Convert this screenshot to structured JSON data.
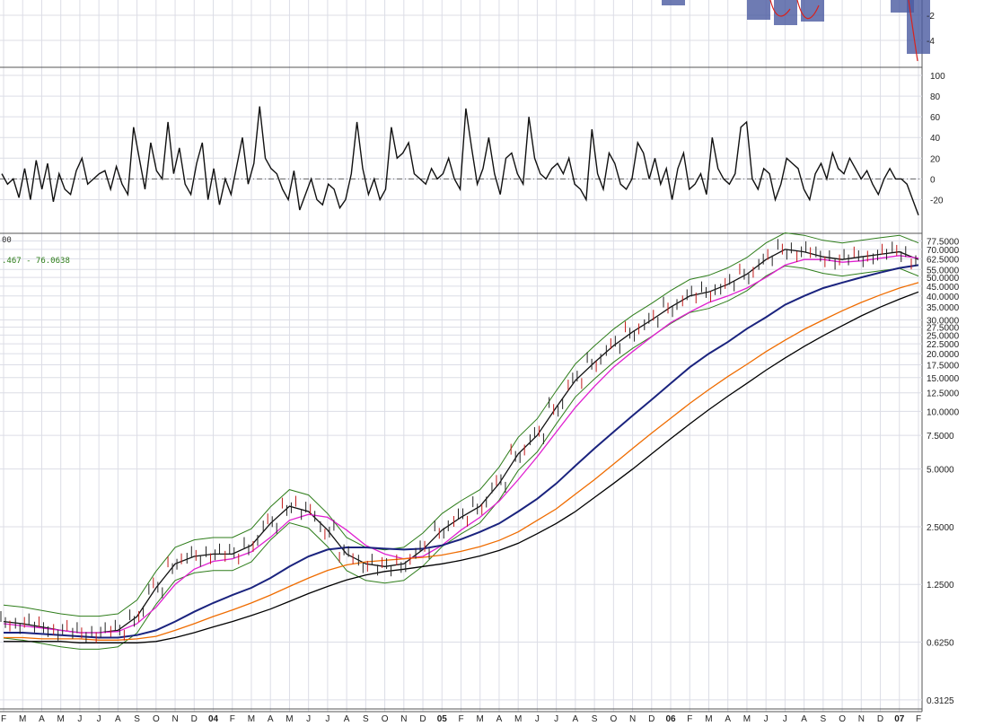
{
  "colors": {
    "background": "#ffffff",
    "grid": "#dcdde6",
    "panel_border": "#555555",
    "momentum_line": "#111111",
    "macd_fill": "#4a5aa0",
    "macd_line": "#d8231d",
    "price_up": "#222222",
    "price_down": "#c11a1a",
    "bollinger": "#2e7d1a"
  },
  "chart_data": [
    {
      "type": "area",
      "panel": "macd-histogram",
      "y_ticks": [
        "-2",
        "-4"
      ],
      "note": "cropped top panel, only lower part visible"
    },
    {
      "type": "line",
      "panel": "momentum-oscillator",
      "y_ticks": [
        "100",
        "80",
        "60",
        "40",
        "20",
        "0",
        "-20"
      ],
      "ylim": [
        -30,
        100
      ],
      "zero_line": "dash-dot",
      "x_months": [
        "F",
        "M",
        "A",
        "M",
        "J",
        "J",
        "A",
        "S",
        "O",
        "N",
        "D",
        "04",
        "F",
        "M",
        "A",
        "M",
        "J",
        "J",
        "A",
        "S",
        "O",
        "N",
        "D",
        "05",
        "F",
        "M",
        "A",
        "M",
        "J",
        "J",
        "A",
        "S",
        "O",
        "N",
        "D",
        "06",
        "F",
        "M",
        "A",
        "M",
        "J",
        "J",
        "A",
        "S",
        "O",
        "N",
        "D",
        "07",
        "F"
      ],
      "values": [
        5,
        -5,
        0,
        -18,
        10,
        -20,
        18,
        -10,
        15,
        -22,
        5,
        -10,
        -15,
        8,
        20,
        -5,
        0,
        5,
        8,
        -10,
        12,
        -5,
        -15,
        50,
        20,
        -10,
        35,
        8,
        0,
        55,
        5,
        30,
        -5,
        -15,
        15,
        35,
        -20,
        10,
        -25,
        0,
        -15,
        12,
        40,
        -5,
        15,
        70,
        20,
        10,
        5,
        -10,
        -20,
        8,
        -30,
        -15,
        0,
        -20,
        -25,
        -5,
        -10,
        -28,
        -20,
        5,
        55,
        10,
        -15,
        0,
        -20,
        -10,
        50,
        20,
        25,
        35,
        5,
        0,
        -5,
        10,
        0,
        5,
        20,
        0,
        -10,
        68,
        30,
        -5,
        10,
        40,
        5,
        -15,
        20,
        25,
        5,
        -5,
        60,
        20,
        5,
        0,
        10,
        15,
        5,
        20,
        -5,
        -10,
        -20,
        48,
        5,
        -10,
        25,
        15,
        -5,
        -10,
        0,
        35,
        25,
        0,
        20,
        -5,
        10,
        -20,
        10,
        25,
        -10,
        -5,
        5,
        -15,
        40,
        10,
        0,
        -5,
        5,
        50,
        55,
        0,
        -10,
        10,
        5,
        -20,
        -5,
        20,
        15,
        10,
        -10,
        -20,
        5,
        15,
        0,
        25,
        10,
        5,
        20,
        10,
        0,
        8,
        -5,
        -15,
        0,
        10,
        0,
        0,
        -5,
        -20,
        -35
      ]
    },
    {
      "type": "line",
      "panel": "price-log",
      "scale": "log",
      "y_ticks": [
        "77.5000",
        "70.0000",
        "62.5000",
        "55.0000",
        "50.0000",
        "45.0000",
        "40.0000",
        "35.0000",
        "30.0000",
        "27.5000",
        "25.0000",
        "22.5000",
        "20.0000",
        "17.5000",
        "15.0000",
        "12.5000",
        "10.0000",
        "7.5000",
        "5.0000",
        "2.5000",
        "1.2500",
        "0.6250",
        "0.3125"
      ],
      "legend_left": "00",
      "legend_values": ".467 - 76.0638",
      "x_months": [
        "F",
        "M",
        "A",
        "M",
        "J",
        "J",
        "A",
        "S",
        "O",
        "N",
        "D",
        "04",
        "F",
        "M",
        "A",
        "M",
        "J",
        "J",
        "A",
        "S",
        "O",
        "N",
        "D",
        "05",
        "F",
        "M",
        "A",
        "M",
        "J",
        "J",
        "A",
        "S",
        "O",
        "N",
        "D",
        "06",
        "F",
        "M",
        "A",
        "M",
        "J",
        "J",
        "A",
        "S",
        "O",
        "N",
        "D",
        "07",
        "F"
      ],
      "year_labels": [
        "04",
        "05",
        "06",
        "07"
      ],
      "series": [
        {
          "color": "#111111",
          "values": [
            0.8,
            0.78,
            0.75,
            0.72,
            0.7,
            0.7,
            0.72,
            0.85,
            1.2,
            1.6,
            1.75,
            1.8,
            1.8,
            2.0,
            2.6,
            3.2,
            3.0,
            2.4,
            1.8,
            1.6,
            1.55,
            1.6,
            1.9,
            2.4,
            2.8,
            3.2,
            4.2,
            6.0,
            7.5,
            10.5,
            14.5,
            18.0,
            22.0,
            26.0,
            30.0,
            35.0,
            40.0,
            42.0,
            46.0,
            52.0,
            62.0,
            70.0,
            68.0,
            64.0,
            62.0,
            64.0,
            66.0,
            68.0,
            62.0
          ]
        },
        {
          "color": "#e020d0",
          "values": [
            0.78,
            0.76,
            0.74,
            0.72,
            0.7,
            0.7,
            0.71,
            0.78,
            0.95,
            1.25,
            1.5,
            1.65,
            1.7,
            1.85,
            2.2,
            2.7,
            2.9,
            2.8,
            2.4,
            2.0,
            1.8,
            1.7,
            1.75,
            2.0,
            2.4,
            2.8,
            3.4,
            4.4,
            5.8,
            7.8,
            10.5,
            13.5,
            17.0,
            20.5,
            24.5,
            29.0,
            33.0,
            37.0,
            40.0,
            44.0,
            50.0,
            58.0,
            62.0,
            62.0,
            60.0,
            61.0,
            63.0,
            65.0,
            63.0
          ]
        },
        {
          "color": "#1a237e",
          "values": [
            0.7,
            0.7,
            0.69,
            0.68,
            0.67,
            0.66,
            0.66,
            0.68,
            0.72,
            0.8,
            0.9,
            1.0,
            1.1,
            1.2,
            1.35,
            1.55,
            1.75,
            1.9,
            1.95,
            1.95,
            1.92,
            1.9,
            1.92,
            2.0,
            2.15,
            2.35,
            2.6,
            3.0,
            3.5,
            4.2,
            5.2,
            6.4,
            7.8,
            9.5,
            11.5,
            14.0,
            17.0,
            20.0,
            23.0,
            27.0,
            31.0,
            36.0,
            40.0,
            44.0,
            47.0,
            50.0,
            53.0,
            56.0,
            58.0
          ]
        },
        {
          "color": "#ef6c00",
          "values": [
            0.66,
            0.66,
            0.65,
            0.65,
            0.65,
            0.64,
            0.64,
            0.65,
            0.67,
            0.72,
            0.78,
            0.85,
            0.92,
            1.0,
            1.1,
            1.22,
            1.35,
            1.48,
            1.58,
            1.64,
            1.67,
            1.7,
            1.73,
            1.78,
            1.86,
            1.97,
            2.12,
            2.35,
            2.7,
            3.1,
            3.7,
            4.4,
            5.3,
            6.4,
            7.7,
            9.2,
            11.0,
            13.0,
            15.2,
            17.6,
            20.5,
            23.5,
            26.8,
            30.0,
            33.5,
            37.0,
            40.5,
            44.0,
            47.0
          ]
        },
        {
          "color": "#000000",
          "values": [
            0.63,
            0.63,
            0.63,
            0.63,
            0.62,
            0.62,
            0.62,
            0.62,
            0.63,
            0.66,
            0.7,
            0.75,
            0.8,
            0.86,
            0.93,
            1.02,
            1.12,
            1.22,
            1.32,
            1.4,
            1.46,
            1.5,
            1.55,
            1.6,
            1.67,
            1.76,
            1.88,
            2.05,
            2.3,
            2.6,
            3.0,
            3.55,
            4.2,
            5.0,
            6.0,
            7.2,
            8.6,
            10.2,
            12.0,
            14.0,
            16.4,
            19.0,
            21.8,
            24.8,
            28.0,
            31.5,
            35.0,
            38.5,
            42.0
          ]
        }
      ]
    }
  ]
}
